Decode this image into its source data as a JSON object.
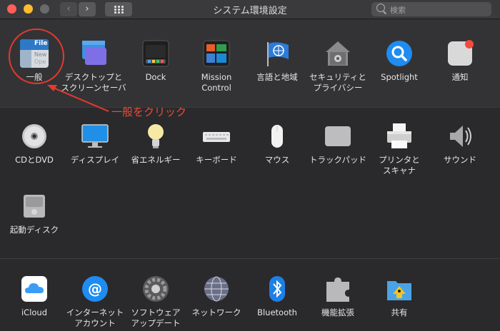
{
  "window": {
    "title": "システム環境設定",
    "search_placeholder": "検索",
    "nav_back": "‹",
    "nav_forward": "›"
  },
  "section1": {
    "items": [
      {
        "label": "一般",
        "icon": "general-icon"
      },
      {
        "label": "デスクトップと\nスクリーンセーバ",
        "icon": "desktop-screensaver-icon"
      },
      {
        "label": "Dock",
        "icon": "dock-icon"
      },
      {
        "label": "Mission\nControl",
        "icon": "mission-control-icon"
      },
      {
        "label": "言語と地域",
        "icon": "language-region-icon"
      },
      {
        "label": "セキュリティと\nプライバシー",
        "icon": "security-privacy-icon"
      },
      {
        "label": "Spotlight",
        "icon": "spotlight-icon"
      },
      {
        "label": "通知",
        "icon": "notifications-icon"
      }
    ]
  },
  "section2": {
    "items": [
      {
        "label": "CDとDVD",
        "icon": "cd-dvd-icon"
      },
      {
        "label": "ディスプレイ",
        "icon": "displays-icon"
      },
      {
        "label": "省エネルギー",
        "icon": "energy-saver-icon"
      },
      {
        "label": "キーボード",
        "icon": "keyboard-icon"
      },
      {
        "label": "マウス",
        "icon": "mouse-icon"
      },
      {
        "label": "トラックパッド",
        "icon": "trackpad-icon"
      },
      {
        "label": "プリンタと\nスキャナ",
        "icon": "printers-scanners-icon"
      },
      {
        "label": "サウンド",
        "icon": "sound-icon"
      },
      {
        "label": "起動ディスク",
        "icon": "startup-disk-icon"
      }
    ]
  },
  "section3": {
    "items": [
      {
        "label": "iCloud",
        "icon": "icloud-icon"
      },
      {
        "label": "インターネット\nアカウント",
        "icon": "internet-accounts-icon"
      },
      {
        "label": "ソフトウェア\nアップデート",
        "icon": "software-update-icon"
      },
      {
        "label": "ネットワーク",
        "icon": "network-icon"
      },
      {
        "label": "Bluetooth",
        "icon": "bluetooth-icon"
      },
      {
        "label": "機能拡張",
        "icon": "extensions-icon"
      },
      {
        "label": "共有",
        "icon": "sharing-icon"
      }
    ]
  },
  "general_icon_text": {
    "line1": "File",
    "line2": "New",
    "line3": "Ope"
  },
  "annotation": {
    "text": "一般をクリック",
    "color": "#e23a30"
  }
}
